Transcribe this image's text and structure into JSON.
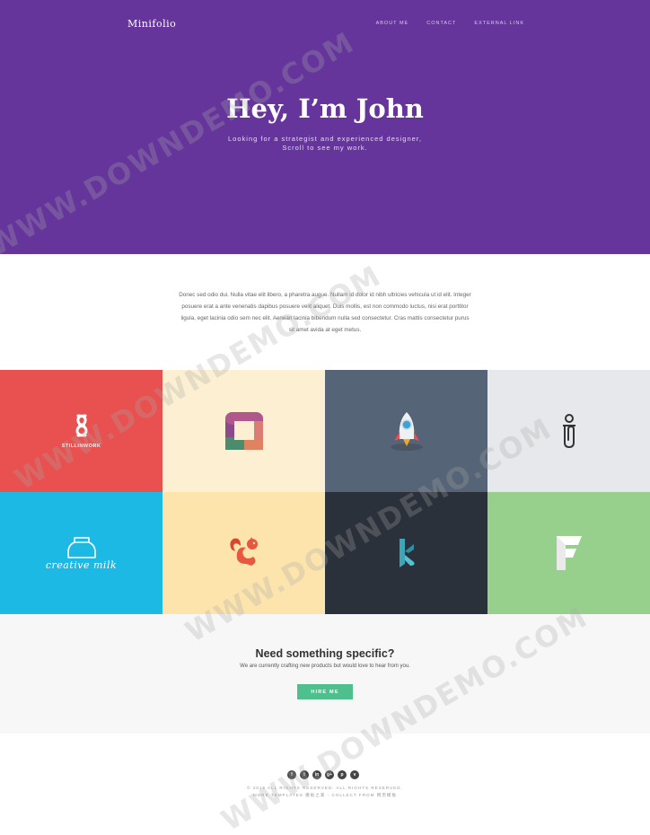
{
  "header": {
    "brand": "Minifolio",
    "nav": [
      "ABOUT ME",
      "CONTACT",
      "EXTERNAL LINK"
    ]
  },
  "hero": {
    "title": "Hey, I’m John",
    "subtitle_lines": [
      "Looking for a strategist and experienced designer,",
      "Scroll to see my work."
    ]
  },
  "intro": {
    "lines": [
      "Donec sed odio dui. Nulla vitae elit libero, a pharetra augue. Nullam id dolor id nibh ultricies vehicula ut id elit. Integer",
      "posuere erat a ante venenatis dapibus posuere velit aliquet. Duis mollis, est non commodo luctus, nisi erat porttitor",
      "ligula, eget lacinia odio sem nec elit. Aenean lacinia bibendum nulla sed consectetur. Cras mattis consectetur purus",
      "sit amet avida at eget metus."
    ]
  },
  "portfolio": {
    "tiles": [
      {
        "bg": "#e8514f",
        "icon": "stillinwork-logo-icon",
        "label": "STILLINWORK"
      },
      {
        "bg": "#fdf0d2",
        "icon": "square-ring-logo-icon",
        "label": ""
      },
      {
        "bg": "#566477",
        "icon": "rocket-icon",
        "label": ""
      },
      {
        "bg": "#e7e8eb",
        "icon": "paperclip-figure-icon",
        "label": ""
      },
      {
        "bg": "#1db9e5",
        "icon": "creative-milk-logo-icon",
        "label": "creative milk"
      },
      {
        "bg": "#fde4ad",
        "icon": "squirrel-icon",
        "label": ""
      },
      {
        "bg": "#2b313a",
        "icon": "letter-k-logo-icon",
        "label": ""
      },
      {
        "bg": "#97d08c",
        "icon": "letter-f-logo-icon",
        "label": ""
      }
    ]
  },
  "cta": {
    "title": "Need something specific?",
    "text": "We are currently crafting new products but would love to hear from you.",
    "button": "HIRE ME"
  },
  "footer": {
    "social_icons": [
      "facebook-icon",
      "twitter-icon",
      "linkedin-icon",
      "google-plus-icon",
      "pinterest-icon",
      "vimeo-icon"
    ],
    "social_glyphs": [
      "f",
      "t",
      "in",
      "g+",
      "p",
      "v"
    ],
    "copyright_lines": [
      "© 2015 ALL RIGHTS RESERVED. ALL RIGHTS RESERVED.",
      "MORE TEMPLATES 模板之家 - COLLECT FROM 网页模板"
    ]
  },
  "watermark": "WWW.DOWNDEMO.COM",
  "colors": {
    "hero_bg": "#65359b",
    "button_green": "#4fc08d",
    "cta_bg": "#f7f7f7"
  }
}
